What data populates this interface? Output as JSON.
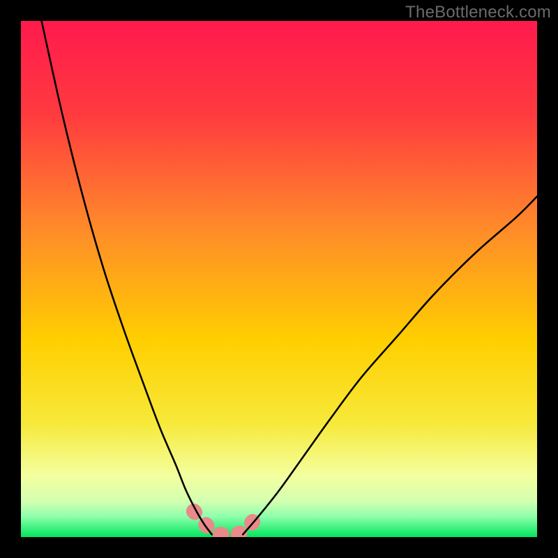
{
  "watermark": "TheBottleneck.com",
  "chart_data": {
    "type": "line",
    "title": "",
    "xlabel": "",
    "ylabel": "",
    "xlim": [
      0,
      100
    ],
    "ylim": [
      0,
      100
    ],
    "grid": false,
    "legend": false,
    "background_gradient_top": "#ff1a4d",
    "background_gradient_mid": "#ffcf00",
    "background_gradient_low": "#f4ff9e",
    "background_gradient_bottom": "#00e65c",
    "series": [
      {
        "name": "left-curve",
        "color": "#000000",
        "x": [
          4,
          8,
          12,
          16,
          20,
          24,
          27,
          30,
          32,
          34,
          35.5,
          37
        ],
        "y": [
          100,
          82,
          66,
          52,
          40,
          29,
          21,
          14,
          9,
          5,
          2.5,
          0.5
        ]
      },
      {
        "name": "right-curve",
        "color": "#000000",
        "x": [
          43,
          46,
          50,
          55,
          60,
          66,
          73,
          80,
          88,
          96,
          100
        ],
        "y": [
          0.5,
          4,
          9,
          16,
          23,
          31,
          39,
          47,
          55,
          62,
          66
        ]
      },
      {
        "name": "bottom-dots",
        "type": "scatter",
        "color": "#e98a8a",
        "x": [
          33.5,
          35.5,
          37.0,
          38.5,
          40.0,
          41.8,
          43.6,
          45.2
        ],
        "y": [
          5.0,
          2.8,
          1.0,
          0.5,
          0.4,
          0.5,
          1.2,
          3.4
        ]
      }
    ],
    "annotations": []
  }
}
